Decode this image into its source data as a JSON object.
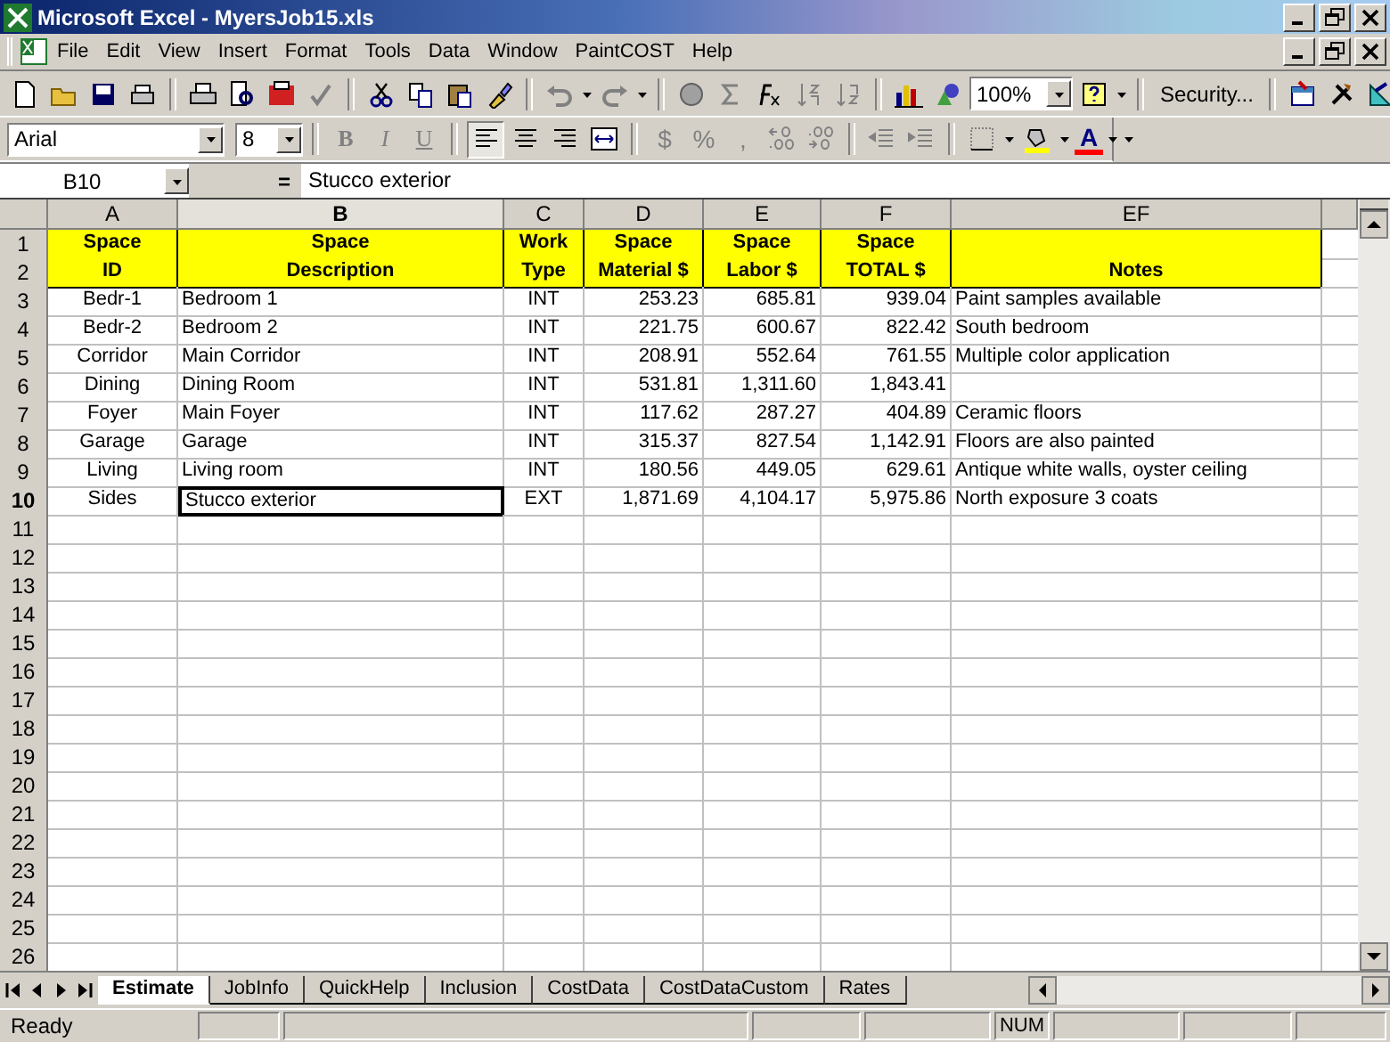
{
  "window": {
    "title": "Microsoft Excel - MyersJob15.xls"
  },
  "menu": [
    "File",
    "Edit",
    "View",
    "Insert",
    "Format",
    "Tools",
    "Data",
    "Window",
    "PaintCOST",
    "Help"
  ],
  "standard_toolbar": {
    "zoom": "100%",
    "security_button": "Security..."
  },
  "formatting_toolbar": {
    "font": "Arial",
    "size": "8",
    "bold": "B",
    "italic": "I",
    "underline": "U",
    "currency": "$",
    "percent": "%",
    "comma": ",",
    "font_color": "A"
  },
  "formula_bar": {
    "name_box": "B10",
    "marker": "=",
    "content": "Stucco exterior"
  },
  "columns": [
    {
      "label": "A",
      "selected": false
    },
    {
      "label": "B",
      "selected": true
    },
    {
      "label": "C",
      "selected": false
    },
    {
      "label": "D",
      "selected": false
    },
    {
      "label": "E",
      "selected": false
    },
    {
      "label": "F",
      "selected": false
    },
    {
      "label": "EF",
      "selected": false
    }
  ],
  "rows": [
    {
      "number": "1",
      "kind": "header",
      "selected": false,
      "cells": [
        "Space",
        "Space",
        "Work",
        "Space",
        "Space",
        "Space",
        null
      ]
    },
    {
      "number": "2",
      "kind": "header",
      "selected": false,
      "cells": [
        "ID",
        "Description",
        "Type",
        "Material $",
        "Labor $",
        "TOTAL $",
        "Notes"
      ]
    },
    {
      "number": "3",
      "kind": "data",
      "selected": false,
      "cells": [
        "Bedr-1",
        "Bedroom 1",
        "INT",
        "253.23",
        "685.81",
        "939.04",
        "Paint samples available"
      ]
    },
    {
      "number": "4",
      "kind": "data",
      "selected": false,
      "cells": [
        "Bedr-2",
        "Bedroom 2",
        "INT",
        "221.75",
        "600.67",
        "822.42",
        "South bedroom"
      ]
    },
    {
      "number": "5",
      "kind": "data",
      "selected": false,
      "cells": [
        "Corridor",
        "Main Corridor",
        "INT",
        "208.91",
        "552.64",
        "761.55",
        "Multiple color application"
      ]
    },
    {
      "number": "6",
      "kind": "data",
      "selected": false,
      "cells": [
        "Dining",
        "Dining Room",
        "INT",
        "531.81",
        "1,311.60",
        "1,843.41",
        null
      ]
    },
    {
      "number": "7",
      "kind": "data",
      "selected": false,
      "cells": [
        "Foyer",
        "Main Foyer",
        "INT",
        "117.62",
        "287.27",
        "404.89",
        "Ceramic floors"
      ]
    },
    {
      "number": "8",
      "kind": "data",
      "selected": false,
      "cells": [
        "Garage",
        "Garage",
        "INT",
        "315.37",
        "827.54",
        "1,142.91",
        "Floors are also painted"
      ]
    },
    {
      "number": "9",
      "kind": "data",
      "selected": false,
      "cells": [
        "Living",
        "Living room",
        "INT",
        "180.56",
        "449.05",
        "629.61",
        "Antique white walls, oyster ceiling"
      ]
    },
    {
      "number": "10",
      "kind": "data",
      "selected": true,
      "cells": [
        "Sides",
        "Stucco exterior",
        "EXT",
        "1,871.69",
        "4,104.17",
        "5,975.86",
        "North exposure 3 coats"
      ]
    },
    {
      "number": "11",
      "kind": "empty",
      "selected": false
    },
    {
      "number": "12",
      "kind": "empty",
      "selected": false
    },
    {
      "number": "13",
      "kind": "empty",
      "selected": false
    },
    {
      "number": "14",
      "kind": "empty",
      "selected": false
    },
    {
      "number": "15",
      "kind": "empty",
      "selected": false
    },
    {
      "number": "16",
      "kind": "empty",
      "selected": false
    },
    {
      "number": "17",
      "kind": "empty",
      "selected": false
    },
    {
      "number": "18",
      "kind": "empty",
      "selected": false
    },
    {
      "number": "19",
      "kind": "empty",
      "selected": false
    },
    {
      "number": "20",
      "kind": "empty",
      "selected": false
    },
    {
      "number": "21",
      "kind": "empty",
      "selected": false
    },
    {
      "number": "22",
      "kind": "empty",
      "selected": false
    },
    {
      "number": "23",
      "kind": "empty",
      "selected": false
    },
    {
      "number": "24",
      "kind": "empty",
      "selected": false
    },
    {
      "number": "25",
      "kind": "empty",
      "selected": false
    },
    {
      "number": "26",
      "kind": "empty",
      "selected": false
    }
  ],
  "sheet_tabs": [
    {
      "label": "Estimate",
      "selected": true
    },
    {
      "label": "JobInfo",
      "selected": false
    },
    {
      "label": "QuickHelp",
      "selected": false
    },
    {
      "label": "Inclusion",
      "selected": false
    },
    {
      "label": "CostData",
      "selected": false
    },
    {
      "label": "CostDataCustom",
      "selected": false
    },
    {
      "label": "Rates",
      "selected": false
    }
  ],
  "status_bar": {
    "message": "Ready",
    "num_lock": "NUM"
  }
}
